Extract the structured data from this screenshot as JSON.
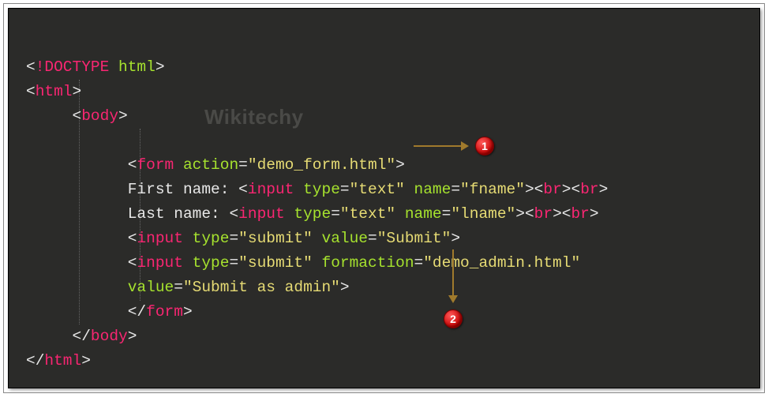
{
  "watermark": "Wikitechy",
  "code": {
    "l1": {
      "open": "<",
      "doctype": "!DOCTYPE",
      "sp": " ",
      "html": "html",
      "close": ">"
    },
    "l2": {
      "open": "<",
      "tag": "html",
      "close": ">"
    },
    "l3": {
      "open": "<",
      "tag": "body",
      "close": ">"
    },
    "l5": {
      "open": "<",
      "tag": "form",
      "sp": " ",
      "attr": "action",
      "eq": "=",
      "val": "\"demo_form.html\"",
      "close": ">"
    },
    "l6": {
      "txt": "First name: ",
      "open": "<",
      "tag": "input",
      "sp": " ",
      "a1": "type",
      "eq1": "=",
      "v1": "\"text\"",
      "sp2": " ",
      "a2": "name",
      "eq2": "=",
      "v2": "\"fname\"",
      "close": ">",
      "br1o": "<",
      "br1": "br",
      "br1c": ">",
      "br2o": "<",
      "br2": "br",
      "br2c": ">"
    },
    "l7": {
      "txt": "Last name: ",
      "open": "<",
      "tag": "input",
      "sp": " ",
      "a1": "type",
      "eq1": "=",
      "v1": "\"text\"",
      "sp2": " ",
      "a2": "name",
      "eq2": "=",
      "v2": "\"lname\"",
      "close": ">",
      "br1o": "<",
      "br1": "br",
      "br1c": ">",
      "br2o": "<",
      "br2": "br",
      "br2c": ">"
    },
    "l8": {
      "open": "<",
      "tag": "input",
      "sp": " ",
      "a1": "type",
      "eq1": "=",
      "v1": "\"submit\"",
      "sp2": " ",
      "a2": "value",
      "eq2": "=",
      "v2": "\"Submit\"",
      "close": ">"
    },
    "l9": {
      "open": "<",
      "tag": "input",
      "sp": " ",
      "a1": "type",
      "eq1": "=",
      "v1": "\"submit\"",
      "sp2": " ",
      "a2": "formaction",
      "eq2": "=",
      "v2": "\"demo_admin.html\""
    },
    "l10": {
      "a": "value",
      "eq": "=",
      "v": "\"Submit as admin\"",
      "close": ">"
    },
    "l11": {
      "open": "</",
      "tag": "form",
      "close": ">"
    },
    "l12": {
      "open": "</",
      "tag": "body",
      "close": ">"
    },
    "l13": {
      "open": "</",
      "tag": "html",
      "close": ">"
    }
  },
  "callouts": {
    "c1": "1",
    "c2": "2"
  }
}
